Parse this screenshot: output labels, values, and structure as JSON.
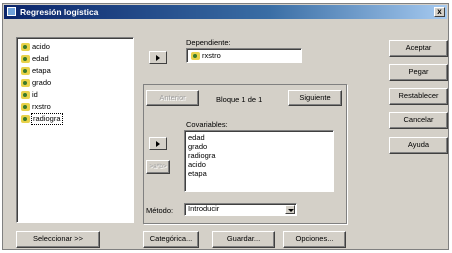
{
  "window": {
    "title": "Regresión logística",
    "close_label": "x"
  },
  "variables": [
    "acido",
    "edad",
    "etapa",
    "grado",
    "id",
    "rxstro",
    "radiogra"
  ],
  "dependent": {
    "label": "Dependiente:",
    "value": "rxstro"
  },
  "block": {
    "prev_label": "Anterior",
    "text": "Bloque 1 de 1",
    "next_label": "Siguiente"
  },
  "covariates": {
    "label": "Covariables:",
    "items": [
      "edad",
      "grado",
      "radiogra",
      "acido",
      "etapa"
    ],
    "interaction_label": ">a*b>"
  },
  "method": {
    "label": "Método:",
    "value": "Introducir"
  },
  "buttons": {
    "accept": "Aceptar",
    "paste": "Pegar",
    "reset": "Restablecer",
    "cancel": "Cancelar",
    "help": "Ayuda"
  },
  "bottom": {
    "select": "Seleccionar >>",
    "categorical": "Categórica...",
    "save": "Guardar...",
    "options": "Opciones..."
  }
}
